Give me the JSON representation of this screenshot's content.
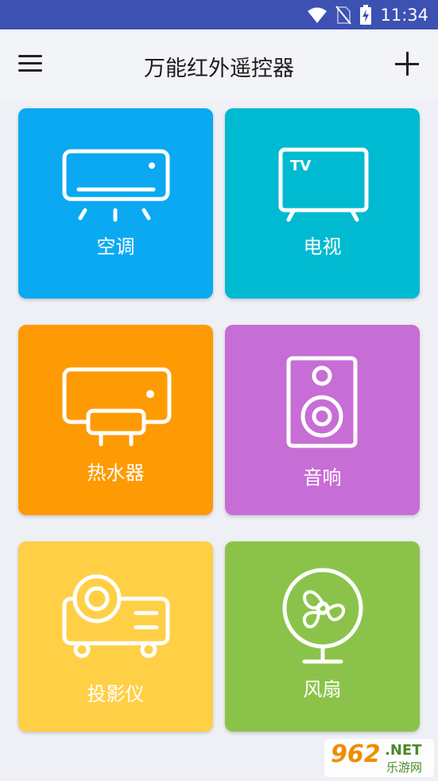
{
  "status_bar": {
    "time": "11:34",
    "icons": [
      "wifi-icon",
      "no-sim-icon",
      "battery-charging-icon"
    ]
  },
  "app_bar": {
    "title": "万能红外遥控器",
    "left_icon": "menu-icon",
    "right_icon": "add-icon"
  },
  "devices": [
    {
      "id": "air-conditioner",
      "label": "空调",
      "color": "#0aa9f2",
      "icon": "air-conditioner-icon"
    },
    {
      "id": "tv",
      "label": "电视",
      "color": "#00bad1",
      "icon": "tv-icon",
      "icon_text": "TV"
    },
    {
      "id": "water-heater",
      "label": "热水器",
      "color": "#fe9a03",
      "icon": "water-heater-icon"
    },
    {
      "id": "speaker",
      "label": "音响",
      "color": "#c76dd6",
      "icon": "speaker-icon"
    },
    {
      "id": "projector",
      "label": "投影仪",
      "color": "#ffcf46",
      "icon": "projector-icon"
    },
    {
      "id": "fan",
      "label": "风扇",
      "color": "#8bc34a",
      "icon": "fan-icon"
    }
  ],
  "watermark": {
    "number": "962",
    "suffix": ".NET",
    "text": "乐游网"
  }
}
